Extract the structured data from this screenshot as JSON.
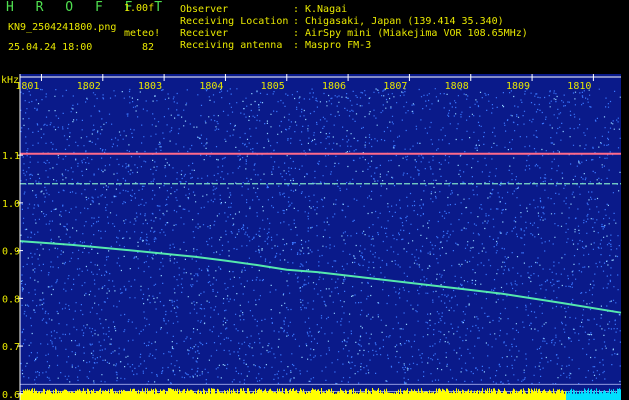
{
  "header": {
    "app_title": "H R O F F T",
    "version": "1.00f",
    "filename": "KN9_2504241800.png",
    "meteo_label": "meteo!",
    "datetime": "25.04.24 18:00",
    "count": "82"
  },
  "info": [
    {
      "label": "Observer",
      "value": "K.Nagai"
    },
    {
      "label": "Receiving Location",
      "value": "Chigasaki, Japan (139.414 35.340)"
    },
    {
      "label": "Receiver",
      "value": "AirSpy mini (Miakejima VOR 108.65MHz)"
    },
    {
      "label": "Receiving antenna",
      "value": "Maspro FM-3"
    }
  ],
  "chart_data": {
    "type": "heatmap",
    "ylabel": "kHz",
    "x_ticks": [
      "1801",
      "1802",
      "1803",
      "1804",
      "1805",
      "1806",
      "1807",
      "1808",
      "1809",
      "1810"
    ],
    "y_ticks": [
      "1.1",
      "1.0",
      "0.9",
      "0.8",
      "0.7",
      "0.6"
    ],
    "y_tick_values": [
      1.1,
      1.0,
      0.9,
      0.8,
      0.7,
      0.6
    ],
    "y_range": [
      0.587,
      1.27
    ],
    "x_range": [
      1800.65,
      1810.45
    ],
    "carrier_lines_khz": [
      1.103,
      1.04
    ],
    "reference_lines_khz": [
      0.62,
      0.605
    ],
    "doppler_trace": {
      "x": [
        1800.65,
        1801.5,
        1802.5,
        1803.5,
        1804.0,
        1804.5,
        1805.0,
        1805.5,
        1806.5,
        1807.5,
        1808.5,
        1809.5,
        1810.45
      ],
      "y": [
        0.92,
        0.912,
        0.9,
        0.887,
        0.879,
        0.87,
        0.86,
        0.855,
        0.84,
        0.825,
        0.81,
        0.79,
        0.77
      ]
    },
    "colors": {
      "background": "#0a1a8a",
      "noise": "#3a78ff",
      "trace": "#5dffb0",
      "carrier": "#ff6a8a",
      "axis": "#ffffff",
      "labels": "#e8e800",
      "baseline": "#ffff00",
      "baseline_alt": "#00e0ff"
    }
  }
}
